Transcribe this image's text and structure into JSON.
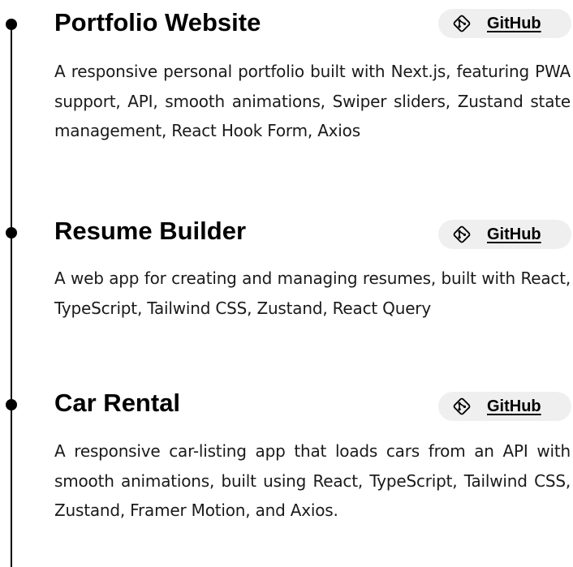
{
  "colors": {
    "text": "#000000",
    "button_bg": "#efefef"
  },
  "projects": [
    {
      "title": "Portfolio Website",
      "link_label": "GitHub",
      "icon": "git-icon",
      "description": "A responsive personal portfolio built with Next.js, featuring PWA support, API, smooth animations, Swiper sliders, Zustand state management, React Hook Form, Axios"
    },
    {
      "title": "Resume Builder",
      "link_label": "GitHub",
      "icon": "git-icon",
      "description": "A web app for creating and managing  resumes, built with React, TypeScript, Tailwind CSS, Zustand, React Query"
    },
    {
      "title": "Car Rental",
      "link_label": "GitHub",
      "icon": "git-icon",
      "description": "A responsive car-listing app that loads cars from an API with smooth animations, built using React, TypeScript, Tailwind CSS, Zustand, Framer Motion, and Axios."
    }
  ]
}
